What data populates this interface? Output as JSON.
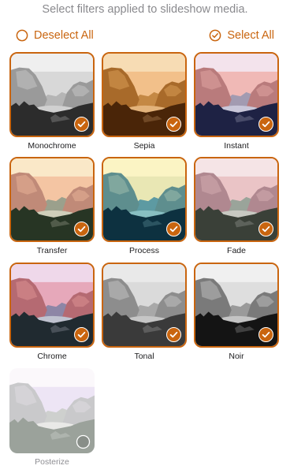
{
  "header": {
    "subtitle": "Select filters applied to slideshow media."
  },
  "actions": {
    "deselect_all": "Deselect All",
    "select_all": "Select All"
  },
  "colors": {
    "accent": "#c9650f"
  },
  "filters": [
    {
      "label": "Monochrome",
      "selected": true,
      "tint": "mono"
    },
    {
      "label": "Sepia",
      "selected": true,
      "tint": "sepia"
    },
    {
      "label": "Instant",
      "selected": true,
      "tint": "instant"
    },
    {
      "label": "Transfer",
      "selected": true,
      "tint": "transfer"
    },
    {
      "label": "Process",
      "selected": true,
      "tint": "process"
    },
    {
      "label": "Fade",
      "selected": true,
      "tint": "fade"
    },
    {
      "label": "Chrome",
      "selected": true,
      "tint": "chrome"
    },
    {
      "label": "Tonal",
      "selected": true,
      "tint": "tonal"
    },
    {
      "label": "Noir",
      "selected": true,
      "tint": "noir"
    },
    {
      "label": "Posterize",
      "selected": false,
      "tint": "posterize"
    }
  ]
}
